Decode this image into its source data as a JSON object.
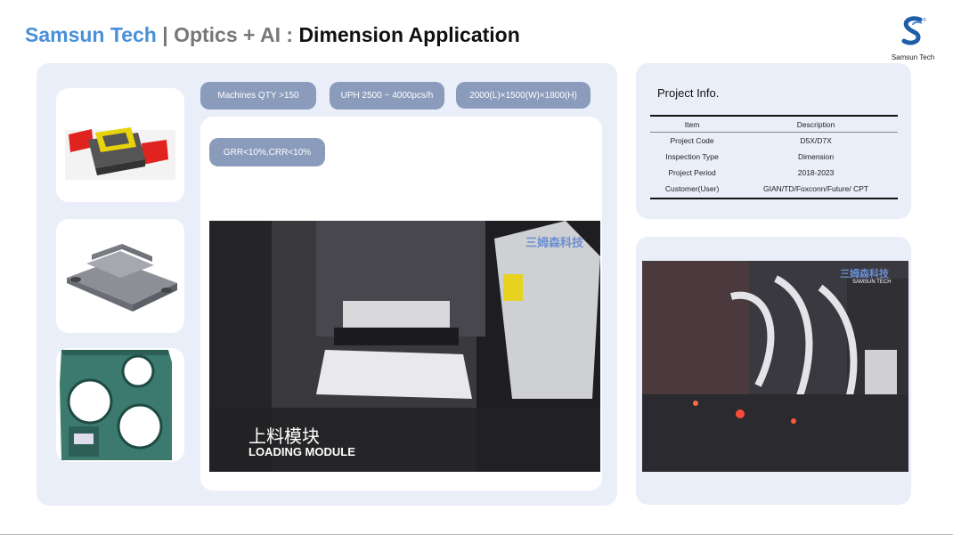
{
  "header": {
    "brand": "Samsun Tech",
    "separator": " | ",
    "subtitle": "Optics + AI : ",
    "title": "Dimension Application"
  },
  "logo": {
    "caption": "Samsun Tech"
  },
  "specs": {
    "machines": "Machines QTY >150",
    "uph": "UPH 2500 ~ 4000pcs/h",
    "size": "2000(L)×1500(W)×1800(H)",
    "grr": "GRR<10%,CRR<10%"
  },
  "video": {
    "title_cn": "上料模块",
    "title_en": "LOADING MODULE",
    "watermark_cn": "三姆森科技"
  },
  "project_info": {
    "heading": "Project Info.",
    "columns": [
      "Item",
      "Description"
    ],
    "rows": [
      [
        "Project Code",
        "D5X/D7X"
      ],
      [
        "Inspection Type",
        "Dimension"
      ],
      [
        "Project Period",
        "2018-2023"
      ],
      [
        "Customer(User)",
        "GIAN/TD/Foxconn/Future/ CPT"
      ]
    ]
  },
  "photo2": {
    "watermark_cn": "三姆森科技",
    "watermark_en": "SAMSUN TECH"
  },
  "colors": {
    "brand": "#4a90d9",
    "panel": "#e9eef8",
    "pill": "#8a9bbb"
  }
}
